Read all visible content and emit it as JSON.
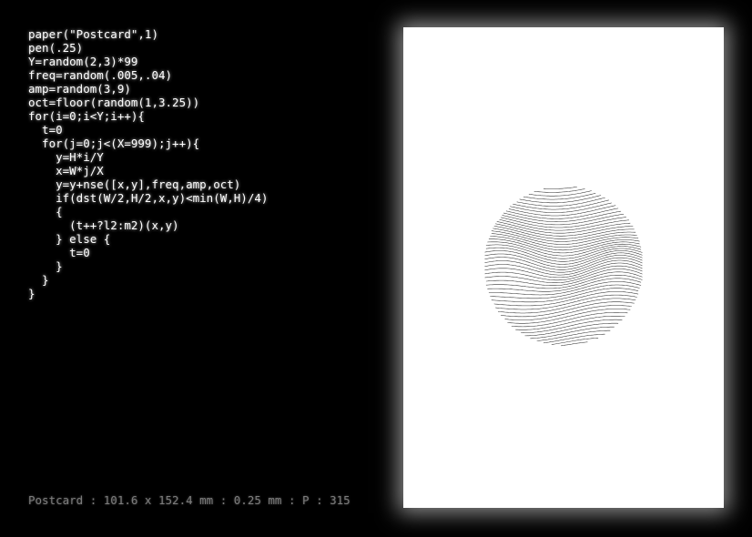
{
  "editor": {
    "code_lines": [
      "paper(\"Postcard\",1)",
      "pen(.25)",
      "Y=random(2,3)*99",
      "freq=random(.005,.04)",
      "amp=random(3,9)",
      "oct=floor(random(1,3.25))",
      "for(i=0;i<Y;i++){",
      "  t=0",
      "  for(j=0;j<(X=999);j++){",
      "    y=H*i/Y",
      "    x=W*j/X",
      "    y=y+nse([x,y],freq,amp,oct)",
      "    if(dst(W/2,H/2,x,y)<min(W,H)/4)",
      "    {",
      "      (t++?l2:m2)(x,y)",
      "    } else {",
      "      t=0",
      "    }",
      "  }",
      "}"
    ]
  },
  "status": {
    "text": "Postcard : 101.6 x 152.4 mm : 0.25 mm : P : 315"
  },
  "preview": {
    "paper_color": "#ffffff",
    "ink_color": "#111111",
    "background_color": "#000000"
  }
}
